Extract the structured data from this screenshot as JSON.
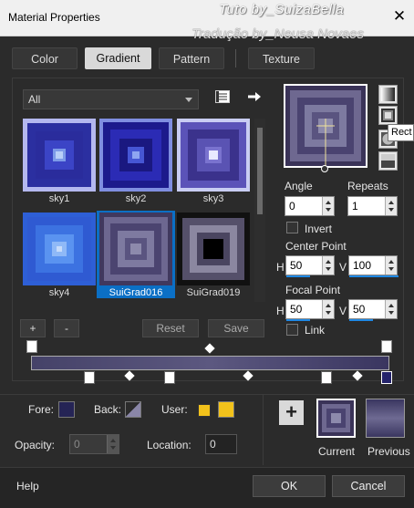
{
  "window": {
    "title": "Material Properties",
    "close_glyph": "✕"
  },
  "watermark": {
    "line1": "Tuto by_SuizaBella",
    "line2": "Tradução by_Neusa Novaes"
  },
  "tabs": [
    {
      "label": "Color",
      "active": false
    },
    {
      "label": "Gradient",
      "active": true
    },
    {
      "label": "Pattern",
      "active": false
    },
    {
      "label": "Texture",
      "active": false
    }
  ],
  "filter": {
    "selected": "All"
  },
  "gradients": [
    {
      "name": "sky1",
      "selected": false
    },
    {
      "name": "sky2",
      "selected": false
    },
    {
      "name": "sky3",
      "selected": false
    },
    {
      "name": "sky4",
      "selected": false
    },
    {
      "name": "SuiGrad016",
      "selected": true
    },
    {
      "name": "SuiGrad019",
      "selected": false
    }
  ],
  "list_buttons": {
    "add": "+",
    "remove": "-",
    "reset": "Reset",
    "save": "Save"
  },
  "tooltip": "Rect",
  "angle": {
    "label": "Angle",
    "value": "0"
  },
  "repeats": {
    "label": "Repeats",
    "value": "1"
  },
  "invert": {
    "label": "Invert",
    "checked": false
  },
  "center_point": {
    "label": "Center Point",
    "h_label": "H",
    "h": "50",
    "v_label": "V",
    "v": "100"
  },
  "focal_point": {
    "label": "Focal Point",
    "h_label": "H",
    "h": "50",
    "v_label": "V",
    "v": "50"
  },
  "link": {
    "label": "Link",
    "checked": false
  },
  "bottom": {
    "fore_label": "Fore:",
    "back_label": "Back:",
    "user_label": "User:",
    "opacity_label": "Opacity:",
    "opacity_value": "0",
    "location_label": "Location:",
    "location_value": "0",
    "add_glyph": "+",
    "current_label": "Current",
    "previous_label": "Previous"
  },
  "footer": {
    "help": "Help",
    "ok": "OK",
    "cancel": "Cancel"
  },
  "colors": {
    "accent": "#0b6fc5",
    "user_color": "#f2c21b",
    "fore": "#252455",
    "panel": "#2b2b2b"
  }
}
